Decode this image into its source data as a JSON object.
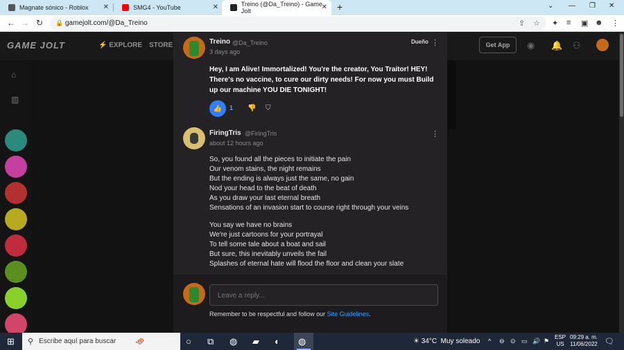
{
  "browser": {
    "tabs": [
      {
        "title": "Magnate sónico - Roblox",
        "favicon_color": "#555555"
      },
      {
        "title": "SMG4 - YouTube",
        "favicon_color": "#ff0000"
      },
      {
        "title": "Treino (@Da_Treino) - Game Jolt",
        "favicon_color": "#222222"
      }
    ],
    "url": "gamejolt.com/@Da_Treino"
  },
  "gamejolt": {
    "logo": "GAME JOLT",
    "nav_explore": "EXPLORE",
    "nav_store": "STORE",
    "get_app": "Get App"
  },
  "post": {
    "author": "Treino",
    "handle": "@Da_Treino",
    "time": "3 days ago",
    "badge": "Dueño",
    "text": "Hey, I am Alive! Immortalized! You're the creator, You Traitor! HEY! There's no vaccine, to cure our dirty needs! For now you must Build up our machine YOU DIE TONIGHT!",
    "likes": "1"
  },
  "reply": {
    "author": "FiringTris",
    "handle": "@FiringTris",
    "time": "about 12 hours ago",
    "lines": [
      "So, you found all the pieces to initiate the pain",
      "Our venom stains, the night remains",
      "But the ending is always just the same, no gain",
      "Nod your head to the beat of death",
      "As you draw your last eternal breath",
      "Sensations of an invasion start to course right through your veins"
    ],
    "lines2": [
      "You say we have no brains",
      "We're just cartoons for your portrayal",
      "To tell some tale about a boat and sail",
      "But sure, this inevitably unveils the fail",
      "Splashes of eternal hate will flood the floor and clean your slate"
    ]
  },
  "composer": {
    "placeholder": "Leave a reply...",
    "guide_prefix": "Remember to be respectful and follow our ",
    "guide_link": "Site Guidelines",
    "guide_suffix": "."
  },
  "taskbar": {
    "search_placeholder": "Escribe aquí para buscar",
    "temperature": "34°C",
    "weather": "Muy soleado",
    "lang1": "ESP",
    "lang2": "US",
    "time": "09:29 a. m.",
    "date": "11/06/2022"
  }
}
